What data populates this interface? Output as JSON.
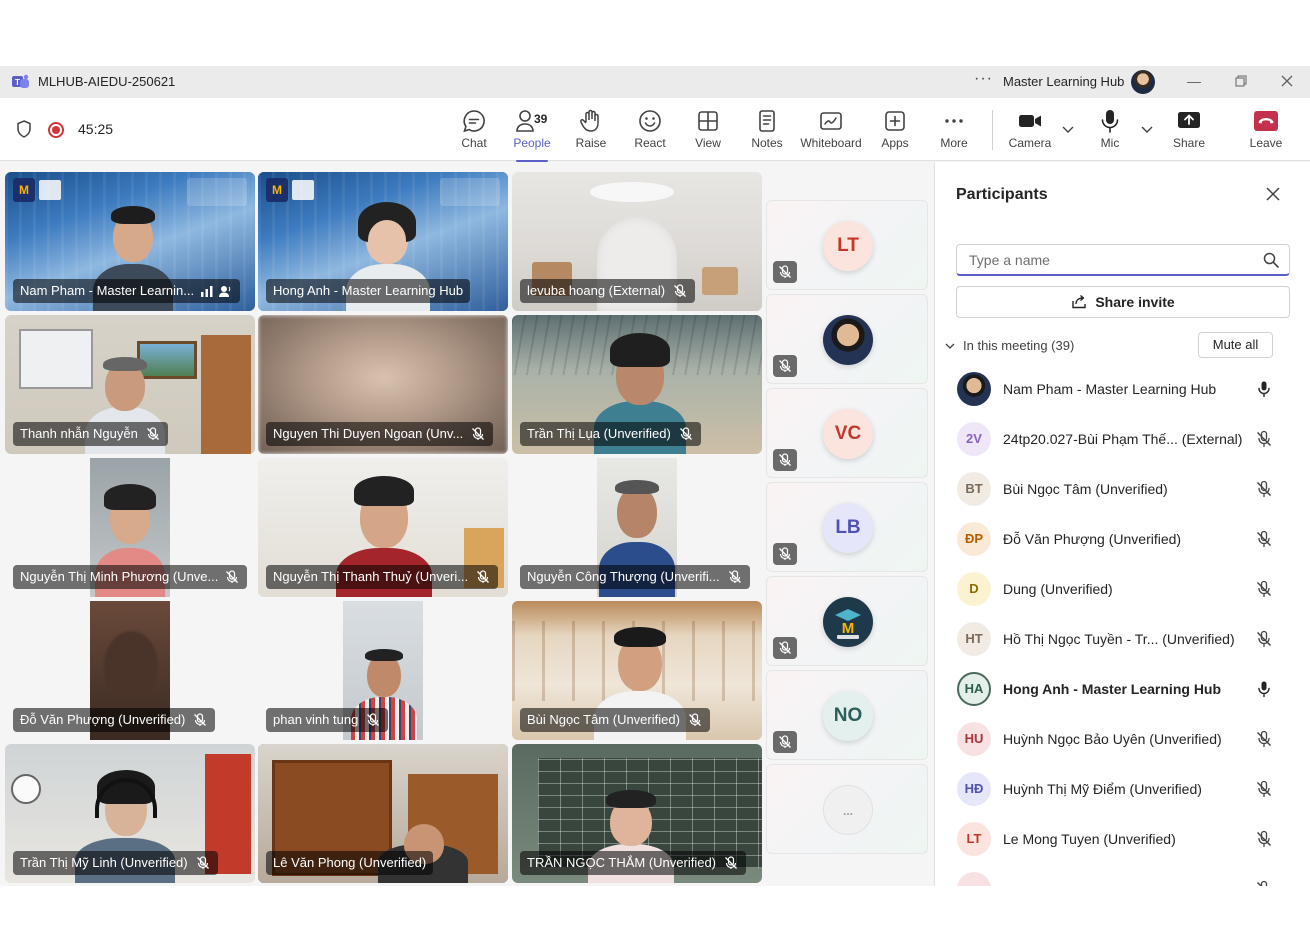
{
  "window": {
    "title": "MLHUB-AIEDU-250621",
    "org": "Master Learning Hub"
  },
  "toolbar": {
    "timer": "45:25",
    "people_count": "39",
    "items": [
      {
        "label": "Chat",
        "icon": "chat-icon"
      },
      {
        "label": "People",
        "icon": "people-icon"
      },
      {
        "label": "Raise",
        "icon": "hand-icon"
      },
      {
        "label": "React",
        "icon": "smiley-icon"
      },
      {
        "label": "View",
        "icon": "grid-icon"
      },
      {
        "label": "Notes",
        "icon": "notes-icon"
      },
      {
        "label": "Whiteboard",
        "icon": "whiteboard-icon"
      },
      {
        "label": "Apps",
        "icon": "plus-icon"
      },
      {
        "label": "More",
        "icon": "more-icon"
      },
      {
        "label": "Camera",
        "icon": "camera-icon"
      },
      {
        "label": "Mic",
        "icon": "mic-icon"
      },
      {
        "label": "Share",
        "icon": "share-icon"
      },
      {
        "label": "Leave",
        "icon": "hangup-icon"
      }
    ],
    "colors": {
      "accent": "#5b5fc7",
      "leave": "#c4314b",
      "record": "#d13438"
    }
  },
  "tiles": [
    {
      "name": "Nam Pham - Master Learnin...",
      "speaking": false
    },
    {
      "name": "Hong Anh - Master Learning Hub",
      "speaking": true
    },
    {
      "name": "levuba hoang (External)",
      "speaking": false
    },
    {
      "name": "Thanh nhẫn Nguyễn",
      "speaking": false
    },
    {
      "name": "Nguyen Thi Duyen Ngoan (Unv...",
      "speaking": false
    },
    {
      "name": "Trần Thị Lụa (Unverified)",
      "speaking": false
    },
    {
      "name": "Nguyễn Thị Minh Phương (Unve...",
      "speaking": false
    },
    {
      "name": "Nguyễn Thị Thanh Thuỷ (Unveri...",
      "speaking": false
    },
    {
      "name": "Nguyễn Công Thượng (Unverifi...",
      "speaking": false
    },
    {
      "name": "Đỗ Văn Phượng (Unverified)",
      "speaking": false
    },
    {
      "name": "phan vinh tung",
      "speaking": false
    },
    {
      "name": "Bùi Ngọc Tâm (Unverified)",
      "speaking": false
    },
    {
      "name": "Trần Thị Mỹ Linh (Unverified)",
      "speaking": false
    },
    {
      "name": "Lê Văn Phong (Unverified)",
      "speaking": true
    },
    {
      "name": "TRẦN NGỌC THẮM (Unverified)",
      "speaking": false
    }
  ],
  "rail": [
    {
      "initials": "LT",
      "color": "#c0392b",
      "bg": "#fbe3de"
    },
    {
      "initials": "",
      "type": "photo"
    },
    {
      "initials": "VC",
      "color": "#c0392b",
      "bg": "#fbe3de"
    },
    {
      "initials": "LB",
      "color": "#4f52b2",
      "bg": "#e6e6fa"
    },
    {
      "initials": "",
      "type": "logo"
    },
    {
      "initials": "NO",
      "color": "#2d5e5a",
      "bg": "#e3f0ee"
    },
    {
      "initials": "...",
      "type": "more"
    }
  ],
  "panel": {
    "title": "Participants",
    "search_placeholder": "Type a name",
    "share_invite": "Share invite",
    "meeting_label": "In this meeting (39)",
    "mute_all": "Mute all",
    "participants": [
      {
        "initials": "",
        "name": "Nam Pham - Master Learning Hub",
        "muted": false,
        "photo": true,
        "bold": false
      },
      {
        "initials": "2V",
        "name": "24tp20.027-Bùi Phạm Thế... (External)",
        "muted": true,
        "color": "#8764b8",
        "bg": "#efe6f7"
      },
      {
        "initials": "BT",
        "name": "Bùi Ngọc Tâm (Unverified)",
        "muted": true,
        "color": "#7a6a5a",
        "bg": "#f1ebe4"
      },
      {
        "initials": "ĐP",
        "name": "Đỗ Văn Phượng (Unverified)",
        "muted": true,
        "color": "#b85c00",
        "bg": "#fbe9d8"
      },
      {
        "initials": "D",
        "name": "Dung (Unverified)",
        "muted": true,
        "color": "#8a6d00",
        "bg": "#fbf3d0"
      },
      {
        "initials": "HT",
        "name": "Hồ Thị Ngọc Tuyền - Tr... (Unverified)",
        "muted": true,
        "color": "#7a6a5a",
        "bg": "#f1ebe4"
      },
      {
        "initials": "HA",
        "name": "Hong Anh - Master Learning Hub",
        "muted": false,
        "color": "#2d5e4a",
        "bg": "#e3efe8",
        "bold": true,
        "ring": true
      },
      {
        "initials": "HU",
        "name": "Huỳnh Ngọc Bảo Uyên (Unverified)",
        "muted": true,
        "color": "#a4373a",
        "bg": "#f8e1e2"
      },
      {
        "initials": "HĐ",
        "name": "Huỳnh Thị Mỹ Điểm (Unverified)",
        "muted": true,
        "color": "#4f52b2",
        "bg": "#e6e6fa"
      },
      {
        "initials": "LT",
        "name": "Le Mong Tuyen (Unverified)",
        "muted": true,
        "color": "#c0392b",
        "bg": "#fbe3de"
      },
      {
        "initials": "",
        "name": "",
        "muted": true,
        "color": "#a4373a",
        "bg": "#f8e1e2"
      }
    ]
  }
}
